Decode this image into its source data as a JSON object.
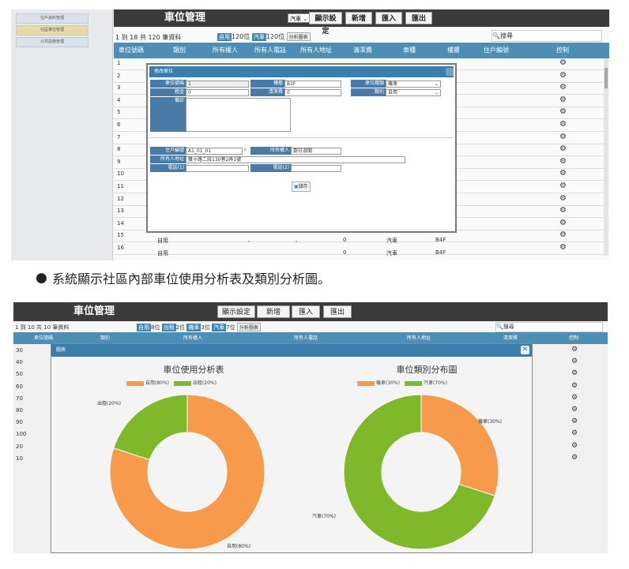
{
  "shot1": {
    "sidebar": [
      "住戶資料管理",
      "社區車位管理",
      "公共設施管理"
    ],
    "title": "車位管理",
    "vehicle_select": "汽車",
    "buttons": {
      "display": "顯示設定",
      "add": "新增",
      "import": "匯入",
      "export": "匯出"
    },
    "info": "1 到 18 共 120 筆資料",
    "tag_self": "自用",
    "self_count": "120位",
    "tag_car": "汽車",
    "car_count": "120位",
    "analysis": "分析圖表",
    "search_label": "搜尋",
    "columns": [
      "車位號碼",
      "類別",
      "所有權人",
      "所有人電話",
      "所有人地址",
      "清潔費",
      "車種",
      "樓層",
      "住戶編號",
      "控制"
    ],
    "row_numbers": [
      "1",
      "2",
      "3",
      "4",
      "5",
      "6",
      "7",
      "8",
      "9",
      "10",
      "11",
      "12",
      "13",
      "14",
      "15",
      "16"
    ],
    "row15": {
      "type": "自用",
      "a": ",",
      "b": ",",
      "fee": "0",
      "vehicle": "汽車",
      "floor": "B4F"
    },
    "row16": {
      "type": "自用",
      "fee": "0",
      "vehicle": "汽車",
      "floor": "B4F"
    },
    "control_icon": "gear-icon",
    "dialog": {
      "title": "修改車位",
      "fields": {
        "slot_no": {
          "label": "車位號碼",
          "value": "1"
        },
        "floor": {
          "label": "樓層",
          "value": "B1F"
        },
        "vehicle": {
          "label": "車位種類",
          "value": "機車"
        },
        "rent": {
          "label": "租金",
          "value": "0"
        },
        "clean": {
          "label": "清潔費",
          "value": "0"
        },
        "category": {
          "label": "類別",
          "value": "自用"
        },
        "note": {
          "label": "備註",
          "value": ""
        },
        "resident_no": {
          "label": "住戶編號",
          "value": "A1_01_01"
        },
        "owner": {
          "label": "所有權人",
          "value": "鄭甘淑聞"
        },
        "owner_addr": {
          "label": "所有人地址",
          "value": "雙十路二段130巷2弄1號"
        },
        "phone1": {
          "label": "電話(1)",
          "value": ""
        },
        "phone2": {
          "label": "電話(2)",
          "value": ""
        }
      },
      "save": "儲存"
    }
  },
  "caption": "系統顯示社區內部車位使用分析表及類別分析圖。",
  "shot2": {
    "title": "車位管理",
    "buttons": {
      "display": "顯示設定",
      "add": "新增",
      "import": "匯入",
      "export": "匯出"
    },
    "info": "1 到 10 共 10 筆資料",
    "tags": [
      {
        "tag": "自用",
        "count": "8位"
      },
      {
        "tag": "出租",
        "count": "2位"
      },
      {
        "tag": "機車",
        "count": "3位"
      },
      {
        "tag": "汽車",
        "count": "7位"
      }
    ],
    "analysis": "分析圖表",
    "search_label": "搜尋",
    "columns": [
      "車位號碼",
      "類別",
      "所有權人",
      "所有人電話",
      "所有人地址",
      "清潔費",
      "控制"
    ],
    "row_numbers": [
      "30",
      "40",
      "50",
      "60",
      "70",
      "80",
      "90",
      "100",
      "20",
      "10"
    ],
    "dialog_title": "圖表",
    "close": "✕"
  },
  "chart_data": [
    {
      "type": "pie",
      "title": "車位使用分析表",
      "categories": [
        "自用",
        "出租"
      ],
      "values": [
        80,
        20
      ],
      "legend": [
        "自用(80%)",
        "出租(20%)"
      ],
      "slice_labels": [
        "自用(80%)",
        "出租(20%)"
      ],
      "colors": [
        "#f79a4c",
        "#80b82c"
      ],
      "donut": true,
      "legend_position": "top"
    },
    {
      "type": "pie",
      "title": "車位類別分布圖",
      "categories": [
        "機車",
        "汽車"
      ],
      "values": [
        30,
        70
      ],
      "legend": [
        "機車(30%)",
        "汽車(70%)"
      ],
      "slice_labels": [
        "機車(30%)",
        "汽車(70%)"
      ],
      "colors": [
        "#f79a4c",
        "#80b82c"
      ],
      "donut": true,
      "legend_position": "top"
    }
  ]
}
